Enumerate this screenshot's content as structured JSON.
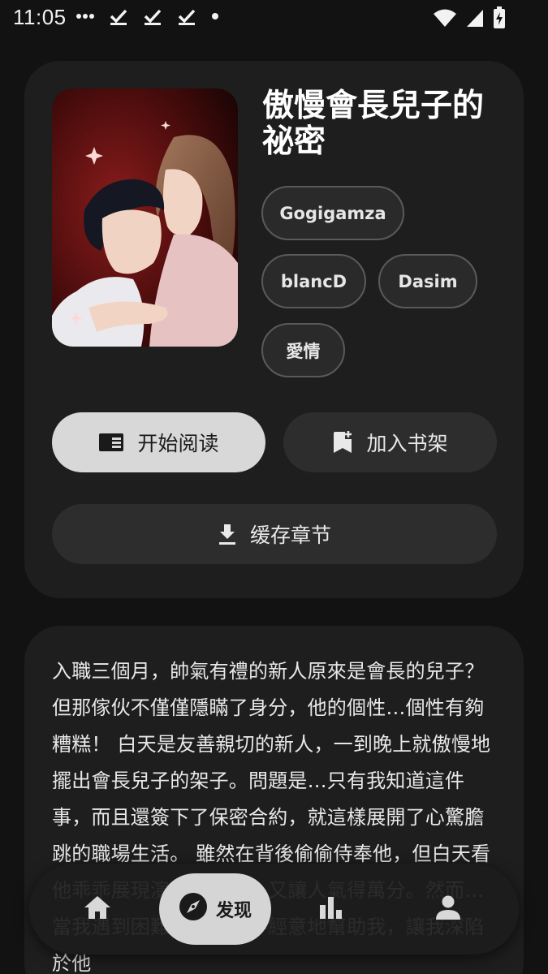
{
  "status_bar": {
    "time": "11:05",
    "left_icons": [
      "more-dots-icon",
      "download-done-icon",
      "download-done-icon",
      "download-done-icon",
      "dot-icon"
    ],
    "right_icons": [
      "wifi-icon",
      "signal-icon",
      "battery-charging-icon"
    ]
  },
  "comic": {
    "title": "傲慢會長兒子的祕密",
    "tags": [
      "Gogigamza",
      "blancD",
      "Dasim",
      "愛情"
    ],
    "cover_icon": "comic-cover-image"
  },
  "actions": {
    "start_reading": "开始阅读",
    "add_to_shelf": "加入书架",
    "cache_chapters": "缓存章节"
  },
  "synopsis": {
    "text": "入職三個月，帥氣有禮的新人原來是會長的兒子？ 但那傢伙不僅僅隱瞞了身分，他的個性…個性有夠糟糕！ 白天是友善親切的新人，一到晚上就傲慢地擺出會長兒子的架子。問題是…只有我知道這件事，而且還簽下了保密合約，就這樣展開了心驚膽跳的職場生活。 雖然在背後偷偷侍奉他，但白天看他乖乖展現演技的樣子，又讓人氣得萬分。然而…當我遇到困難，他又會不經意地幫助我，讓我深陷於他"
  },
  "bottom_nav": {
    "items": [
      {
        "icon": "home-icon",
        "label": ""
      },
      {
        "icon": "compass-icon",
        "label": "发现"
      },
      {
        "icon": "bar-chart-icon",
        "label": ""
      },
      {
        "icon": "person-icon",
        "label": ""
      }
    ]
  },
  "colors": {
    "background": "#121212",
    "card": "#1e1e1e",
    "primary_button": "#d8d8d8",
    "secondary_button": "#2d2d2d"
  }
}
